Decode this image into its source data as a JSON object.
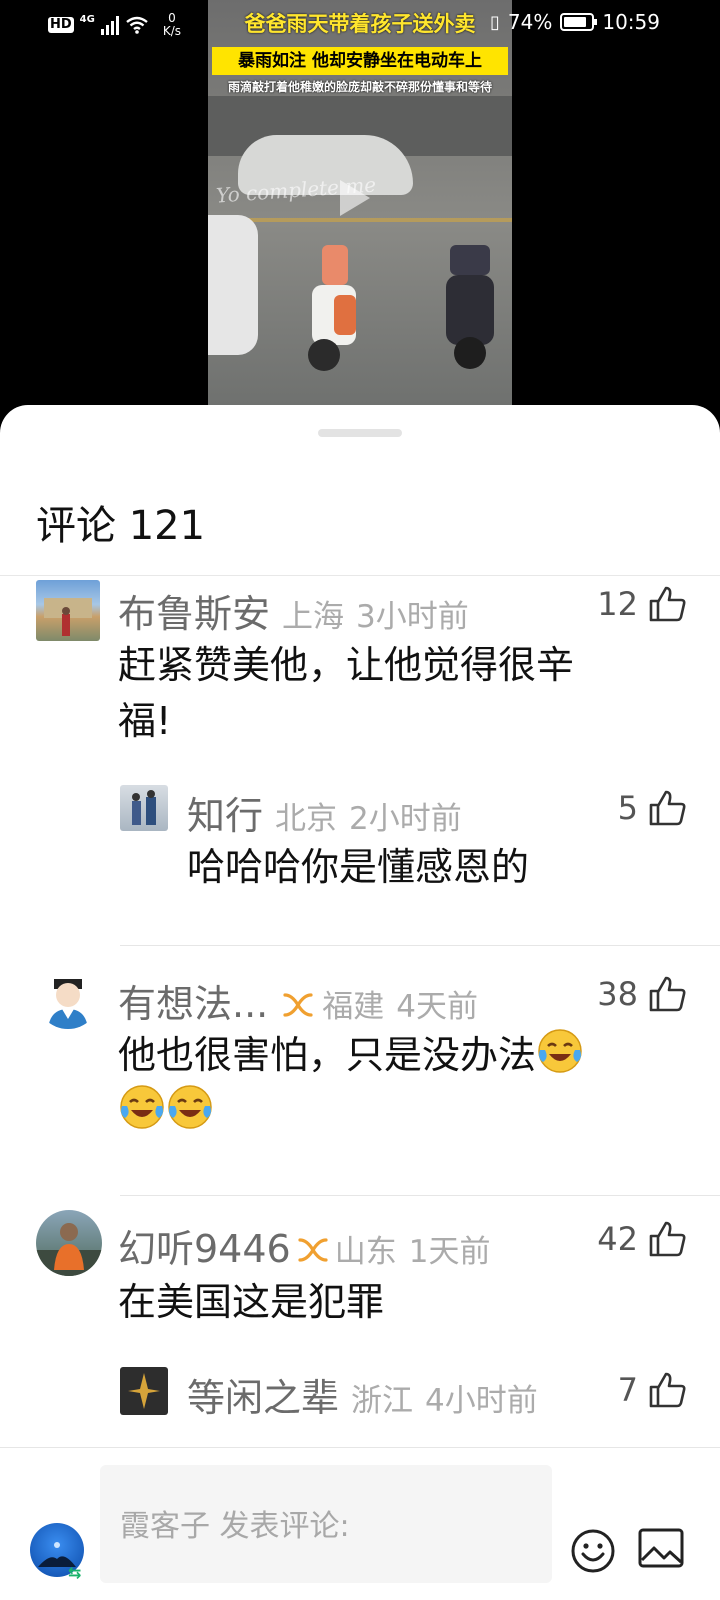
{
  "status_bar": {
    "hd": "HD",
    "network": "4G",
    "speed_value": "0",
    "speed_unit": "K/s",
    "battery": "74%",
    "time": "10:59"
  },
  "video": {
    "title": "爸爸雨天带着孩子送外卖",
    "subtitle1": "暴雨如注 他却安静坐在电动车上",
    "subtitle2": "雨滴敲打着他稚嫩的脸庞却敲不碎那份懂事和等待"
  },
  "comments_header": {
    "label": "评论",
    "count": "121"
  },
  "comments": [
    {
      "user": "布鲁斯安",
      "location": "上海",
      "time": "3小时前",
      "likes": "12",
      "text_line1": "赶紧赞美他，让他觉得很辛",
      "text_line2": "福!"
    },
    {
      "user": "知行",
      "location": "北京",
      "time": "2小时前",
      "likes": "5",
      "text_line1": "哈哈哈你是懂感恩的"
    },
    {
      "user": "有想法...",
      "location": "福建",
      "time": "4天前",
      "likes": "38",
      "text_line1": "他也很害怕，只是没办法",
      "emoji": "laughing-crying-emoji"
    },
    {
      "user": "幻听9446",
      "location": "山东",
      "time": "1天前",
      "likes": "42",
      "text_line1": "在美国这是犯罪"
    },
    {
      "user": "等闲之辈",
      "location": "浙江",
      "time": "4小时前",
      "likes": "7"
    }
  ],
  "composer": {
    "placeholder": "霞客子 发表评论:"
  },
  "colors": {
    "accent_badge": "#f0a030",
    "text_primary": "#111111",
    "text_secondary": "#6b6b6b",
    "text_meta": "#ababab"
  }
}
